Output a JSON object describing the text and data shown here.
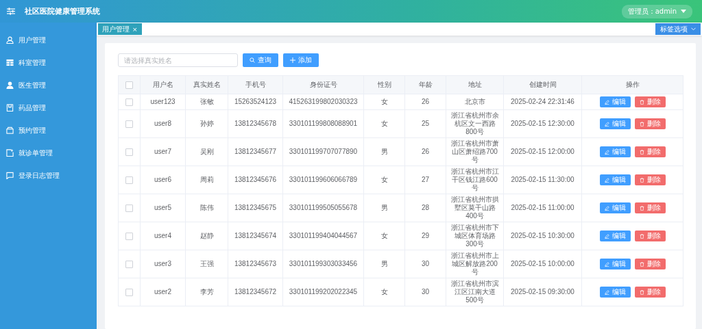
{
  "header": {
    "title": "社区医院健康管理系统",
    "user_menu": "管理员：admin"
  },
  "sidebar": {
    "items": [
      {
        "label": "用户管理"
      },
      {
        "label": "科室管理"
      },
      {
        "label": "医生管理"
      },
      {
        "label": "药品管理"
      },
      {
        "label": "预约管理"
      },
      {
        "label": "就诊单管理"
      },
      {
        "label": "登录日志管理"
      }
    ]
  },
  "tabs": [
    {
      "label": "用户管理",
      "close": "×",
      "selected": true
    }
  ],
  "tab_options": "标签选项",
  "search": {
    "placeholder": "请选择真实姓名"
  },
  "buttons": {
    "query": "查询",
    "add": "添加"
  },
  "table": {
    "header_checked": false,
    "columns": [
      "用户名",
      "真实姓名",
      "手机号",
      "身份证号",
      "性别",
      "年龄",
      "地址",
      "创建时间",
      "操作"
    ],
    "rows": [
      {
        "checked": false,
        "cells": [
          "user123",
          "张敏",
          "15263524123",
          "415263199802030323",
          "女",
          "26",
          "北京市",
          "2025-02-24 22:31:46"
        ],
        "edit": "编辑",
        "delete": "删除"
      },
      {
        "checked": false,
        "cells": [
          "user8",
          "孙婷",
          "13812345678",
          "330101199808088901",
          "女",
          "25",
          "浙江省杭州市余杭区文一西路800号",
          "2025-02-15 12:30:00"
        ],
        "edit": "编辑",
        "delete": "删除"
      },
      {
        "checked": false,
        "cells": [
          "user7",
          "吴刚",
          "13812345677",
          "330101199707077890",
          "男",
          "26",
          "浙江省杭州市萧山区萧绍路700号",
          "2025-02-15 12:00:00"
        ],
        "edit": "编辑",
        "delete": "删除"
      },
      {
        "checked": false,
        "cells": [
          "user6",
          "周莉",
          "13812345676",
          "330101199606066789",
          "女",
          "27",
          "浙江省杭州市江干区钱江路600号",
          "2025-02-15 11:30:00"
        ],
        "edit": "编辑",
        "delete": "删除"
      },
      {
        "checked": false,
        "cells": [
          "user5",
          "陈伟",
          "13812345675",
          "330101199505055678",
          "男",
          "28",
          "浙江省杭州市拱墅区莫干山路400号",
          "2025-02-15 11:00:00"
        ],
        "edit": "编辑",
        "delete": "删除"
      },
      {
        "checked": false,
        "cells": [
          "user4",
          "赵静",
          "13812345674",
          "330101199404044567",
          "女",
          "29",
          "浙江省杭州市下城区体育场路300号",
          "2025-02-15 10:30:00"
        ],
        "edit": "编辑",
        "delete": "删除"
      },
      {
        "checked": false,
        "cells": [
          "user3",
          "王强",
          "13812345673",
          "330101199303033456",
          "男",
          "30",
          "浙江省杭州市上城区解放路200号",
          "2025-02-15 10:00:00"
        ],
        "edit": "编辑",
        "delete": "删除"
      },
      {
        "checked": false,
        "cells": [
          "user2",
          "李芳",
          "13812345672",
          "330101199202022345",
          "女",
          "30",
          "浙江省杭州市滨江区江南大道500号",
          "2025-02-15 09:30:00"
        ],
        "edit": "编辑",
        "delete": "删除"
      }
    ]
  }
}
